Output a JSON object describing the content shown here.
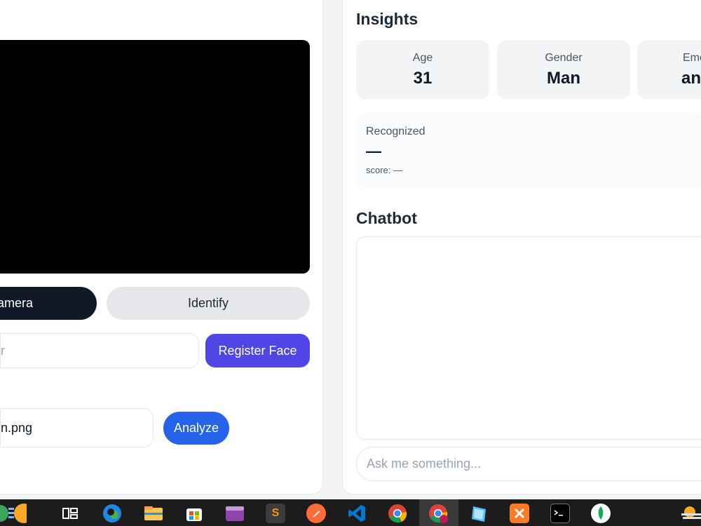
{
  "left_panel": {
    "camera_button_label": "amera",
    "identify_button_label": "Identify",
    "name_input_value": "r",
    "register_button_label": "Register Face",
    "file_input_value": "n.png",
    "analyze_button_label": "Analyze"
  },
  "insights": {
    "title": "Insights",
    "stats": [
      {
        "label": "Age",
        "value": "31"
      },
      {
        "label": "Gender",
        "value": "Man"
      },
      {
        "label": "Emo",
        "value": "an"
      }
    ],
    "recognized": {
      "label": "Recognized",
      "name": "—",
      "score_text": "score: —"
    }
  },
  "chatbot": {
    "title": "Chatbot",
    "input_placeholder": "Ask me something..."
  },
  "taskbar": {
    "icons": [
      "windows-partial-icon",
      "task-view-icon",
      "edge-icon",
      "file-explorer-icon",
      "store-icon",
      "clipchamp-icon",
      "sublime-text-icon",
      "postman-icon",
      "vscode-icon",
      "chrome-icon",
      "chrome-profile-icon",
      "app-icon",
      "xampp-icon",
      "terminal-icon",
      "mongodb-icon",
      "weather-icon"
    ]
  },
  "colors": {
    "primary_dark": "#111827",
    "register": "#4f46e5",
    "analyze": "#2563eb",
    "taskbar": "#1c1c1c"
  }
}
